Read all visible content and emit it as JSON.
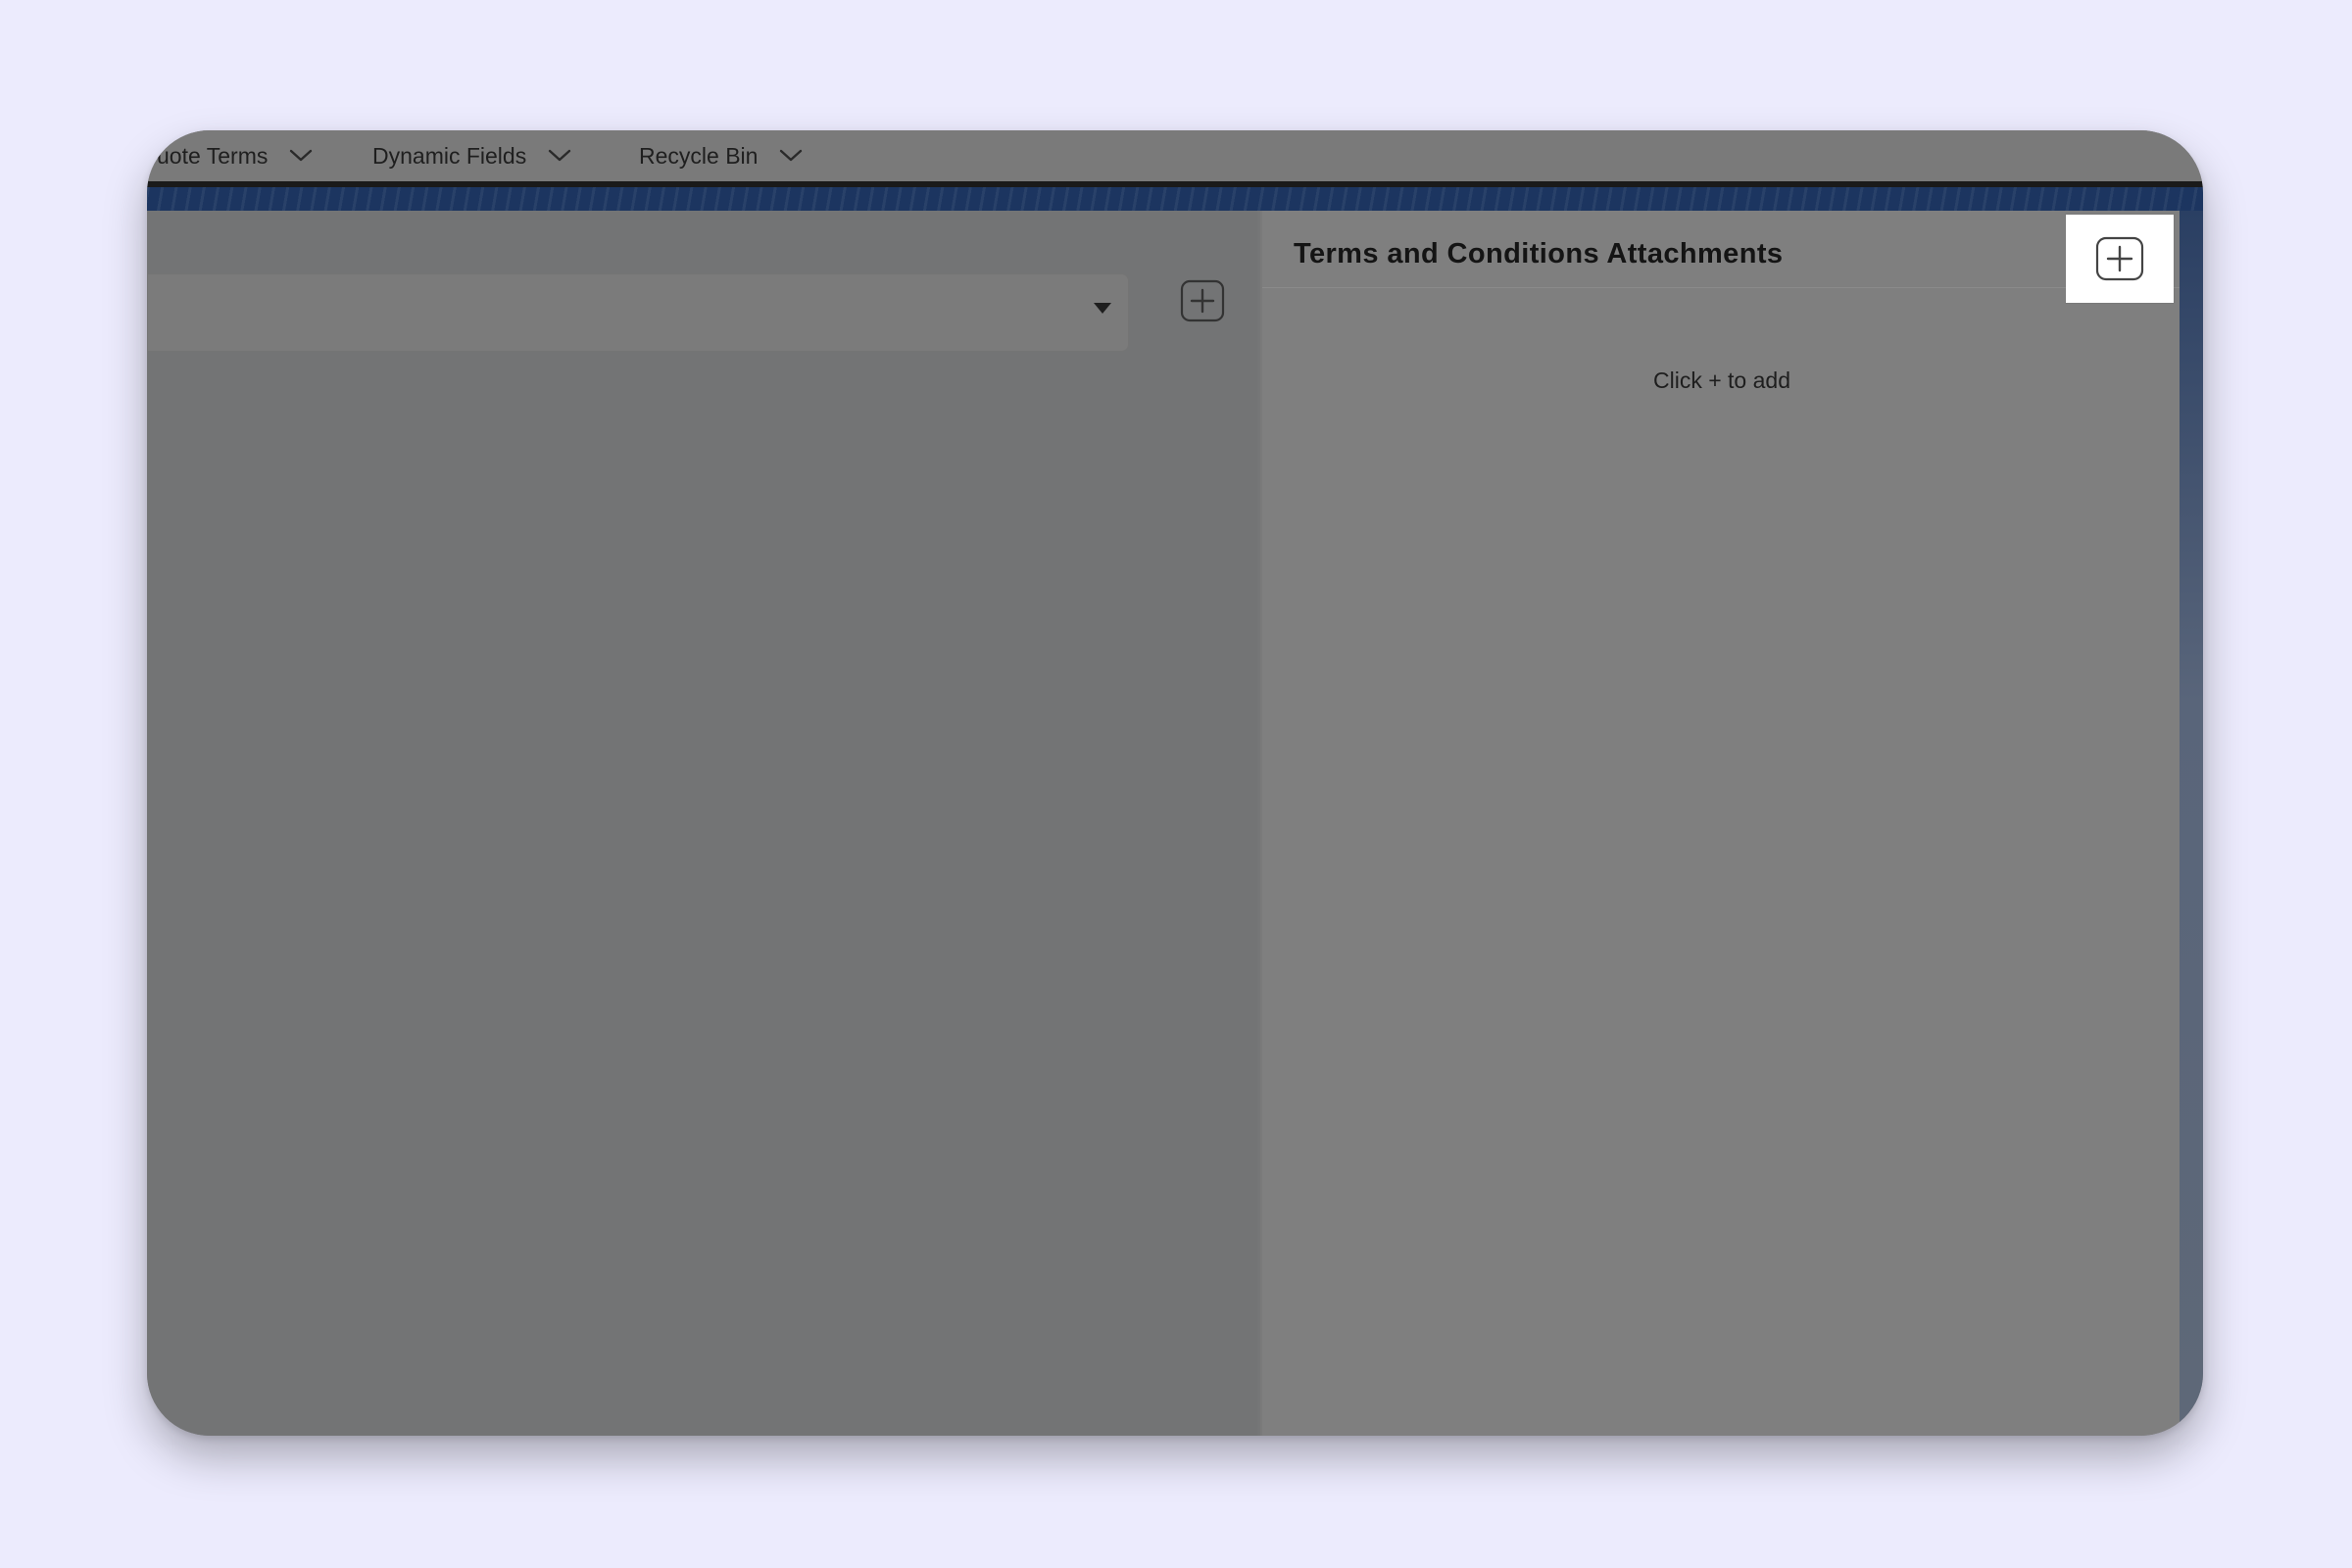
{
  "nav": {
    "tabs": [
      {
        "label": "uote Terms"
      },
      {
        "label": "Dynamic Fields"
      },
      {
        "label": "Recycle Bin"
      }
    ]
  },
  "left_panel": {
    "select_value": "",
    "add_icon": "plus-square-icon"
  },
  "attachments_panel": {
    "title": "Terms and Conditions Attachments",
    "empty_hint": "Click + to add",
    "add_icon": "plus-square-icon"
  },
  "colors": {
    "page_background": "#ecebfd",
    "overlay_gray": "#757677",
    "banner_navy": "#1c3560",
    "highlight": "#ffffff"
  }
}
